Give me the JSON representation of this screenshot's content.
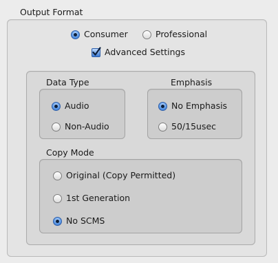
{
  "output_format": {
    "title": "Output Format",
    "consumer_label": "Consumer",
    "professional_label": "Professional",
    "selected": "Consumer",
    "advanced_settings_label": "Advanced Settings",
    "advanced_settings_checked": true
  },
  "data_type": {
    "title": "Data Type",
    "options": [
      "Audio",
      "Non-Audio"
    ],
    "selected": "Audio"
  },
  "emphasis": {
    "title": "Emphasis",
    "options": [
      "No Emphasis",
      "50/15usec"
    ],
    "selected": "No Emphasis"
  },
  "copy_mode": {
    "title": "Copy Mode",
    "options": [
      "Original (Copy Permitted)",
      "1st Generation",
      "No SCMS"
    ],
    "selected": "No SCMS"
  },
  "colors": {
    "window_bg": "#ececec",
    "selection_blue": "#3a79d2"
  },
  "icons": {
    "radio_selected": "radio-selected-icon",
    "radio_unselected": "radio-unselected-icon",
    "checkbox_checked": "checkmark-icon"
  }
}
